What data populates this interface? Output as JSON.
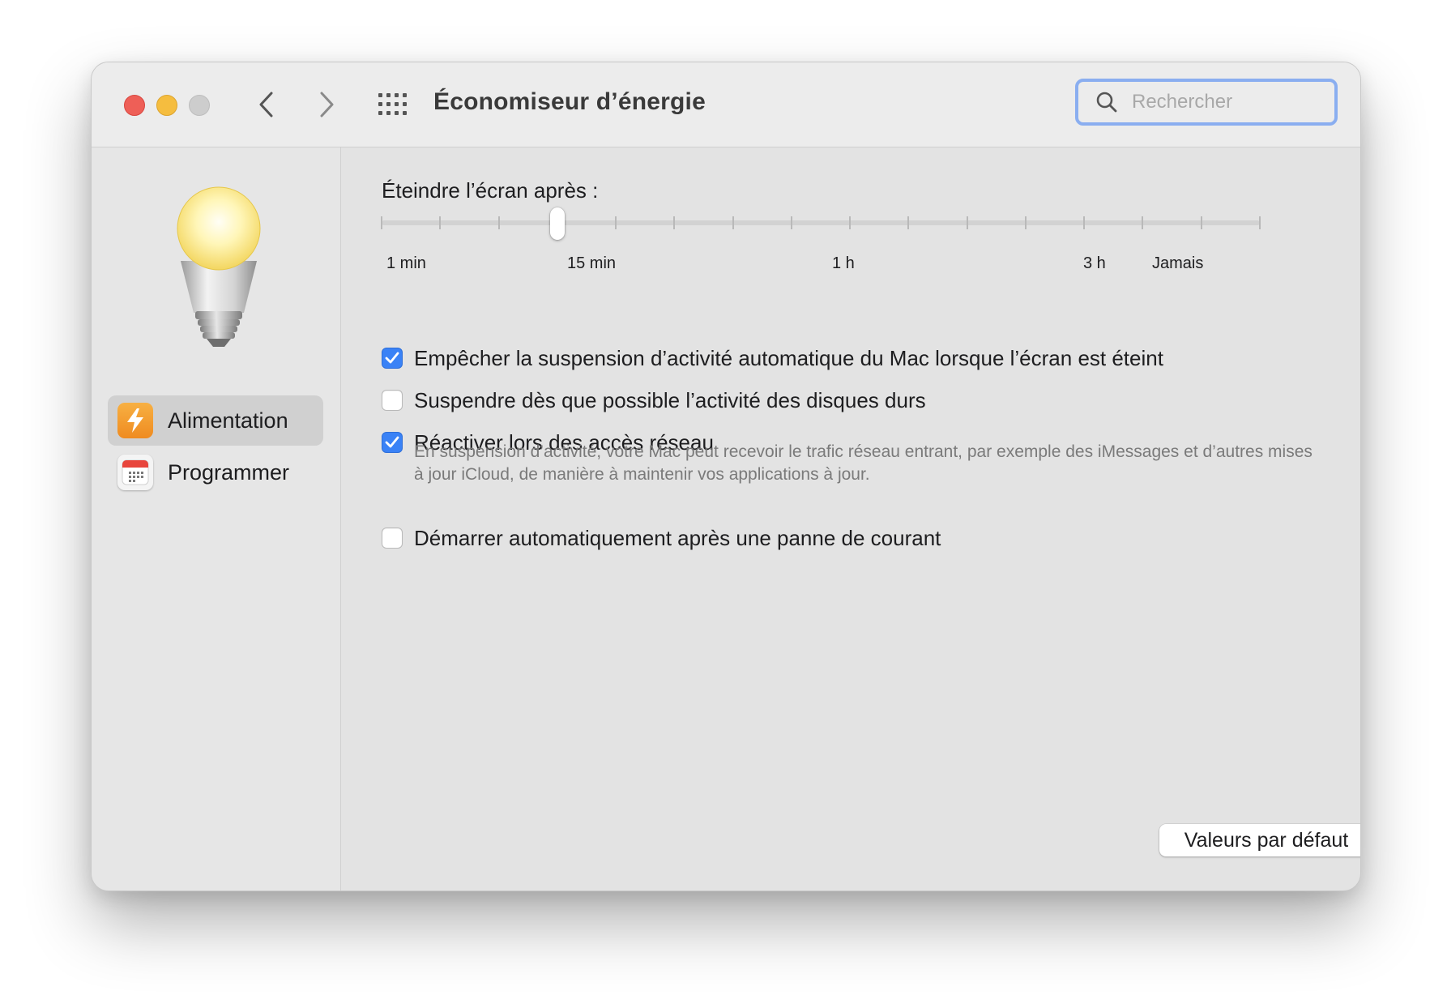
{
  "window": {
    "title": "Économiseur d’énergie"
  },
  "toolbar": {
    "back_icon": "chevron-left-icon",
    "forward_icon": "chevron-right-icon",
    "grid_icon": "show-all-grid-icon"
  },
  "search": {
    "placeholder": "Rechercher",
    "value": ""
  },
  "sidebar": {
    "header_icon": "lightbulb-icon",
    "items": [
      {
        "label": "Alimentation",
        "icon": "lightning-bolt-icon",
        "selected": true
      },
      {
        "label": "Programmer",
        "icon": "calendar-icon",
        "selected": false
      }
    ]
  },
  "display_sleep": {
    "label": "Éteindre l’écran après :",
    "scale_labels": [
      "1 min",
      "15 min",
      "1 h",
      "3 h",
      "Jamais"
    ],
    "selected_stop": 3,
    "stop_count": 16
  },
  "options": [
    {
      "label": "Empêcher la suspension d’activité automatique du Mac lorsque l’écran est éteint",
      "checked": true
    },
    {
      "label": "Suspendre dès que possible l’activité des disques durs",
      "checked": false
    },
    {
      "label": "Réactiver lors des accès réseau",
      "checked": true
    },
    {
      "label": "Démarrer automatiquement après une panne de courant",
      "checked": false
    }
  ],
  "network_note": "En suspension d’activité, votre Mac peut recevoir le trafic réseau entrant, par exemple des iMessages et d’autres mises à jour iCloud, de manière à maintenir vos applications à jour.",
  "footer": {
    "defaults_label": "Valeurs par défaut",
    "help_label": "?"
  },
  "colors": {
    "accent": "#3a82f6",
    "close": "#ee5f57",
    "minimize": "#f5bd3f",
    "zoom_disabled": "#cdcdcd",
    "search_focus": "#8aaef0",
    "power_icon": "#f39a2b"
  }
}
